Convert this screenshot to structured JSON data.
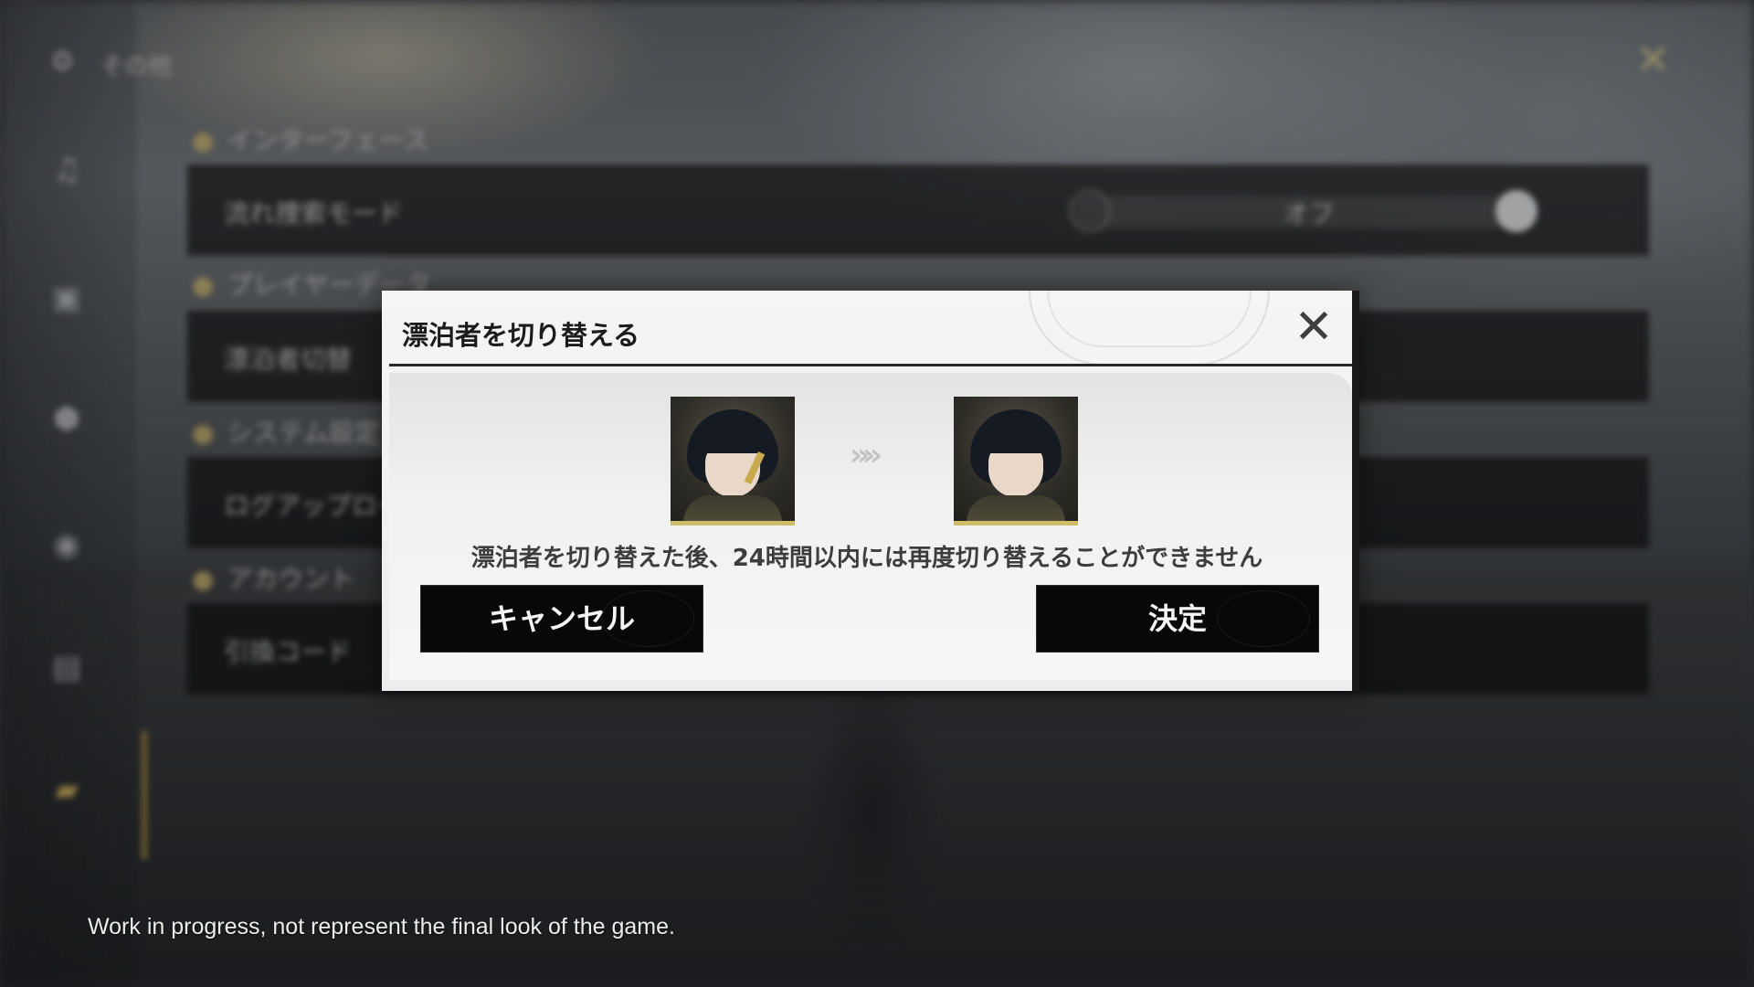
{
  "background_settings": {
    "header_label": "その他",
    "sections": [
      {
        "label": "インターフェース"
      },
      {
        "label": "プレイヤーデータ"
      },
      {
        "label": "システム設定"
      },
      {
        "label": "アカウント"
      }
    ],
    "rows": [
      {
        "label": "流れ捜索モード",
        "value": "オフ"
      },
      {
        "label": "漂泊者切替"
      },
      {
        "label": "ログアップロード"
      },
      {
        "label": "引換コード"
      }
    ],
    "sidebar_icons": [
      "music-icon",
      "display-icon",
      "shield-icon",
      "gamepad-icon",
      "keyboard-icon",
      "folder-icon"
    ]
  },
  "dialog": {
    "title": "漂泊者を切り替える",
    "message": "漂泊者を切り替えた後、24時間以内には再度切り替えることができません",
    "cancel_label": "キャンセル",
    "confirm_label": "決定",
    "arrow_glyph": "»»",
    "close_glyph": "✕"
  },
  "footnote": "Work in progress, not represent the final look of the game.",
  "colors": {
    "accent_gold": "#cdbd68",
    "button_bg": "#080808",
    "dialog_bg": "#f2f2f2"
  }
}
